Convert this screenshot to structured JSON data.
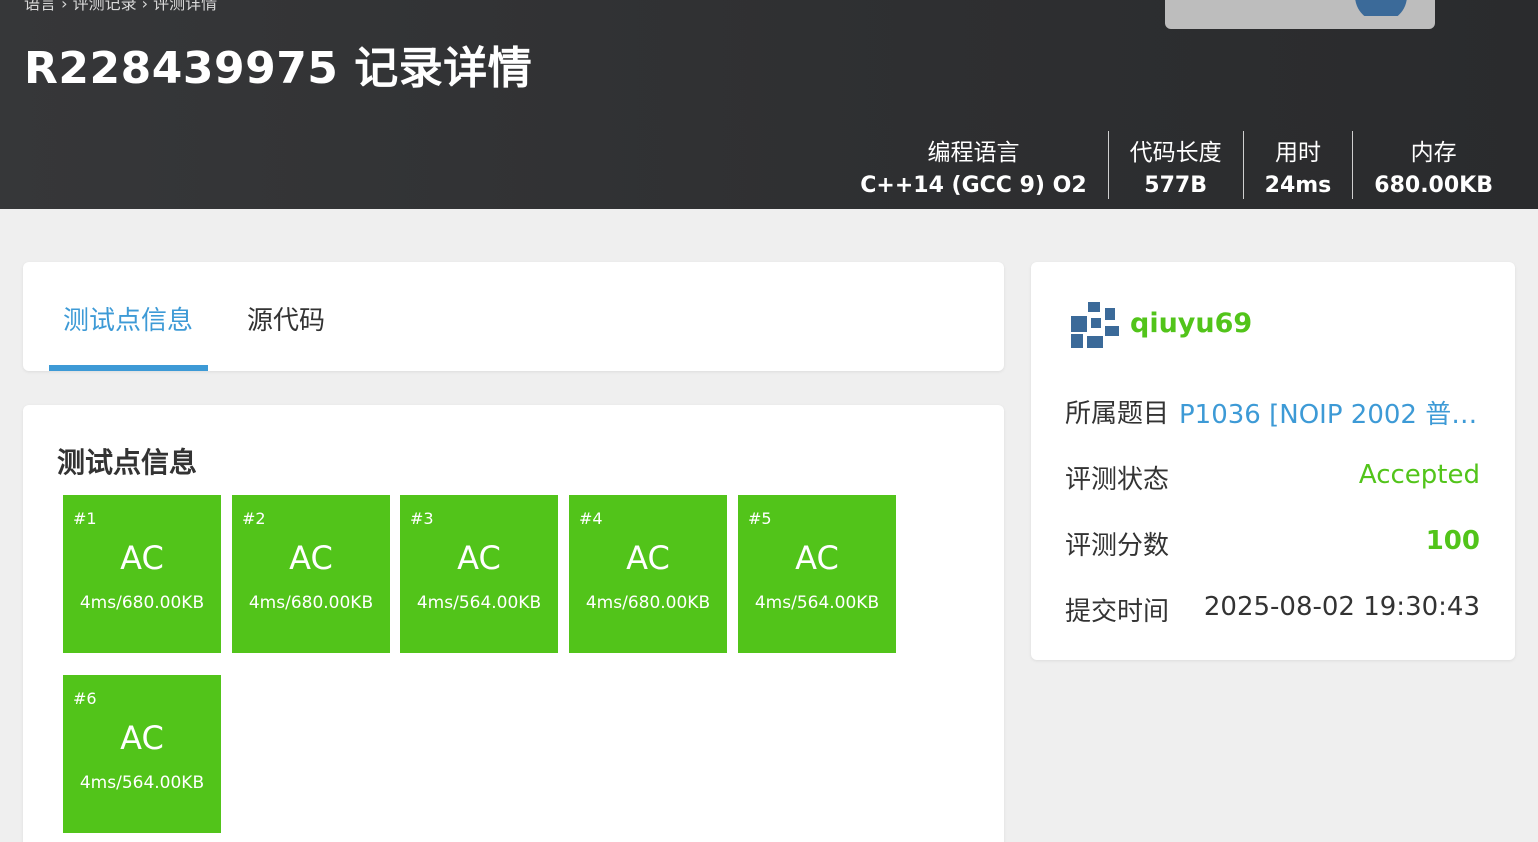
{
  "header": {
    "breadcrumb": "语言 › 评测记录 › 评测详情",
    "title": "R228439975 记录详情",
    "stats": [
      {
        "label": "编程语言",
        "value": "C++14 (GCC 9) O2"
      },
      {
        "label": "代码长度",
        "value": "577B"
      },
      {
        "label": "用时",
        "value": "24ms"
      },
      {
        "label": "内存",
        "value": "680.00KB"
      }
    ]
  },
  "tabs": [
    {
      "label": "测试点信息",
      "active": true
    },
    {
      "label": "源代码",
      "active": false
    }
  ],
  "test_cases": {
    "title": "测试点信息",
    "items": [
      {
        "num": "#1",
        "status": "AC",
        "detail": "4ms/680.00KB"
      },
      {
        "num": "#2",
        "status": "AC",
        "detail": "4ms/680.00KB"
      },
      {
        "num": "#3",
        "status": "AC",
        "detail": "4ms/564.00KB"
      },
      {
        "num": "#4",
        "status": "AC",
        "detail": "4ms/680.00KB"
      },
      {
        "num": "#5",
        "status": "AC",
        "detail": "4ms/564.00KB"
      },
      {
        "num": "#6",
        "status": "AC",
        "detail": "4ms/564.00KB"
      }
    ]
  },
  "sidebar": {
    "username": "qiuyu69",
    "problem_label": "所属题目",
    "problem_value": "P1036 [NOIP 2002 普…",
    "status_label": "评测状态",
    "status_value": "Accepted",
    "score_label": "评测分数",
    "score_value": "100",
    "time_label": "提交时间",
    "time_value": "2025-08-02 19:30:43"
  },
  "colors": {
    "accepted": "#52c41a",
    "link": "#3d9ad6",
    "header_bg": "#303133",
    "avatar": "#3b6a99"
  },
  "icons": {
    "avatar": "pixel-avatar-icon"
  }
}
